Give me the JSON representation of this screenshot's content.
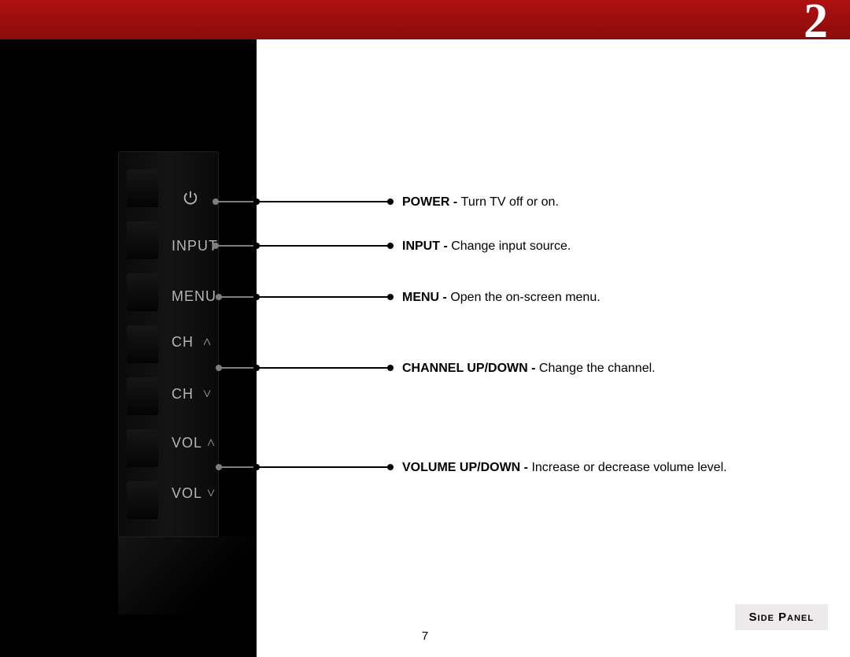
{
  "chapter_number": "2",
  "panel": {
    "buttons": {
      "input": "INPUT",
      "menu": "MENU",
      "ch_up": "CH",
      "ch_down": "CH",
      "vol_up": "VOL",
      "vol_down": "VOL"
    },
    "carets": {
      "up": "˄",
      "down": "˅"
    }
  },
  "callouts": {
    "power": {
      "bold": "POWER - ",
      "text": "Turn TV off or on."
    },
    "input": {
      "bold": "INPUT - ",
      "text": "Change input source."
    },
    "menu": {
      "bold": "MENU - ",
      "text": "Open the on-screen menu."
    },
    "channel": {
      "bold": "CHANNEL UP/DOWN - ",
      "text": "Change the channel."
    },
    "volume": {
      "bold": "VOLUME UP/DOWN - ",
      "text": "Increase or decrease volume level."
    }
  },
  "footer_label": "Side Panel",
  "page_number": "7"
}
